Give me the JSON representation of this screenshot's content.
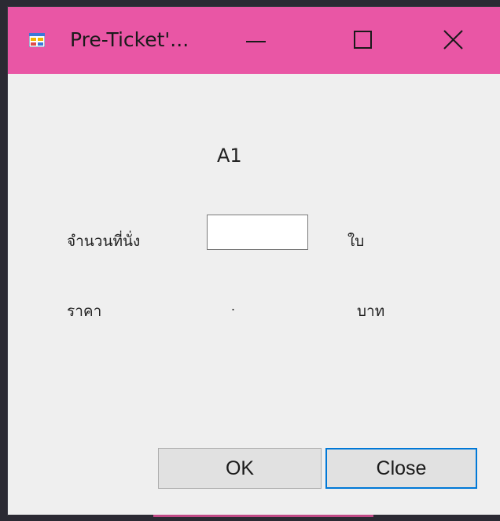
{
  "window": {
    "title": "Pre-Ticket'...",
    "app_icon": "form-icon",
    "title_bar_color": "#e956a5",
    "controls": {
      "minimize": "minimize-icon",
      "maximize": "maximize-icon",
      "close": "close-icon"
    }
  },
  "form": {
    "seat": "A1",
    "quantity_label": "จำนวนที่นั่ง",
    "quantity_value": "",
    "quantity_unit": "ใบ",
    "price_label": "ราคา",
    "price_value": ".",
    "price_currency": "บาท"
  },
  "buttons": {
    "ok": "OK",
    "close": "Close"
  },
  "colors": {
    "focus_border": "#0078d7",
    "dialog_background": "#efefef"
  }
}
